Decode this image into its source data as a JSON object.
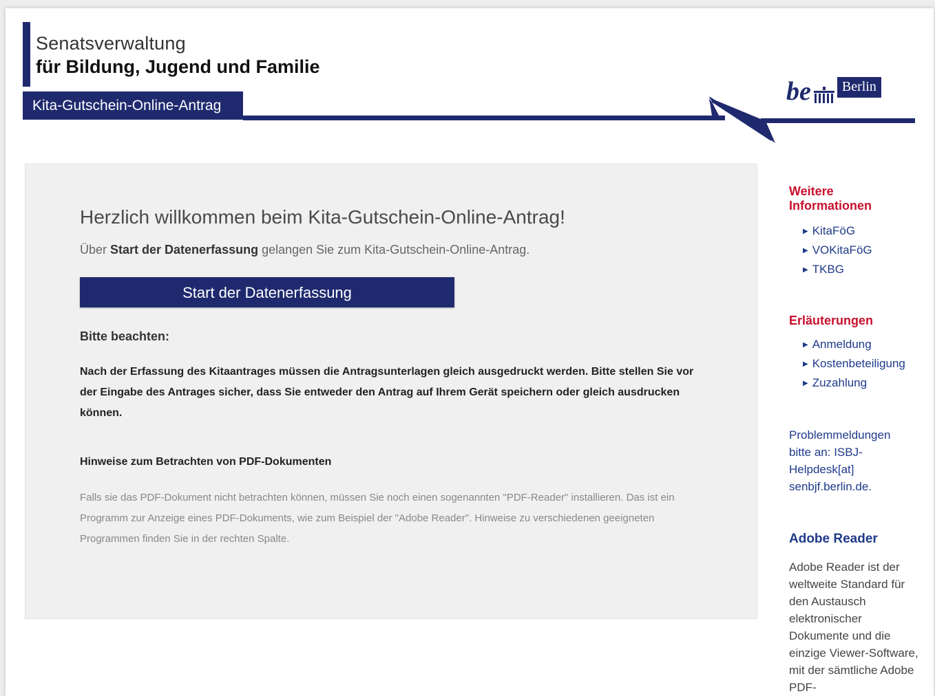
{
  "header": {
    "line1": "Senatsverwaltung",
    "line2": "für Bildung, Jugend und Familie",
    "tab": "Kita-Gutschein-Online-Antrag",
    "logo_be": "be",
    "logo_berlin": "Berlin",
    "brand_color": "#1f2a6e"
  },
  "main": {
    "welcome": "Herzlich willkommen beim Kita-Gutschein-Online-Antrag!",
    "intro_pre": "Über ",
    "intro_bold": "Start der Datenerfassung",
    "intro_post": " gelangen Sie zum Kita-Gutschein-Online-Antrag.",
    "start_button": "Start der Datenerfassung",
    "note_title": "Bitte beachten:",
    "note_text": "Nach der Erfassung des Kitaantrages müssen die Antragsunterlagen gleich ausgedruckt werden. Bitte stellen Sie vor der Eingabe des Antrages sicher, dass Sie entweder den Antrag auf Ihrem Gerät speichern oder gleich ausdrucken können.",
    "pdf_title": "Hinweise zum Betrachten von PDF-Dokumenten",
    "pdf_text": "Falls sie das PDF-Dokument nicht betrachten können, müssen Sie noch einen sogenannten \"PDF-Reader\" installieren. Das ist ein Programm zur Anzeige eines PDF-Dokuments, wie zum Beispiel der \"Adobe Reader\". Hinweise zu verschiedenen geeigneten Programmen finden Sie in der rechten Spalte."
  },
  "sidebar": {
    "info_heading": "Weitere Informationen",
    "info_links": [
      "KitaFöG",
      "VOKitaFöG",
      "TKBG"
    ],
    "explain_heading": "Erläuterungen",
    "explain_links": [
      "Anmeldung",
      "Kostenbeteiligung",
      "Zuzahlung"
    ],
    "problem_text": "Problemmeldungen bitte an: ISBJ-Helpdesk[at] senbjf.berlin.de.",
    "adobe_heading": "Adobe Reader",
    "adobe_text": "Adobe Reader ist der weltweite Standard für den Austausch elektronischer Dokumente und die einzige Viewer-Software, mit der sämtliche Adobe PDF-"
  }
}
